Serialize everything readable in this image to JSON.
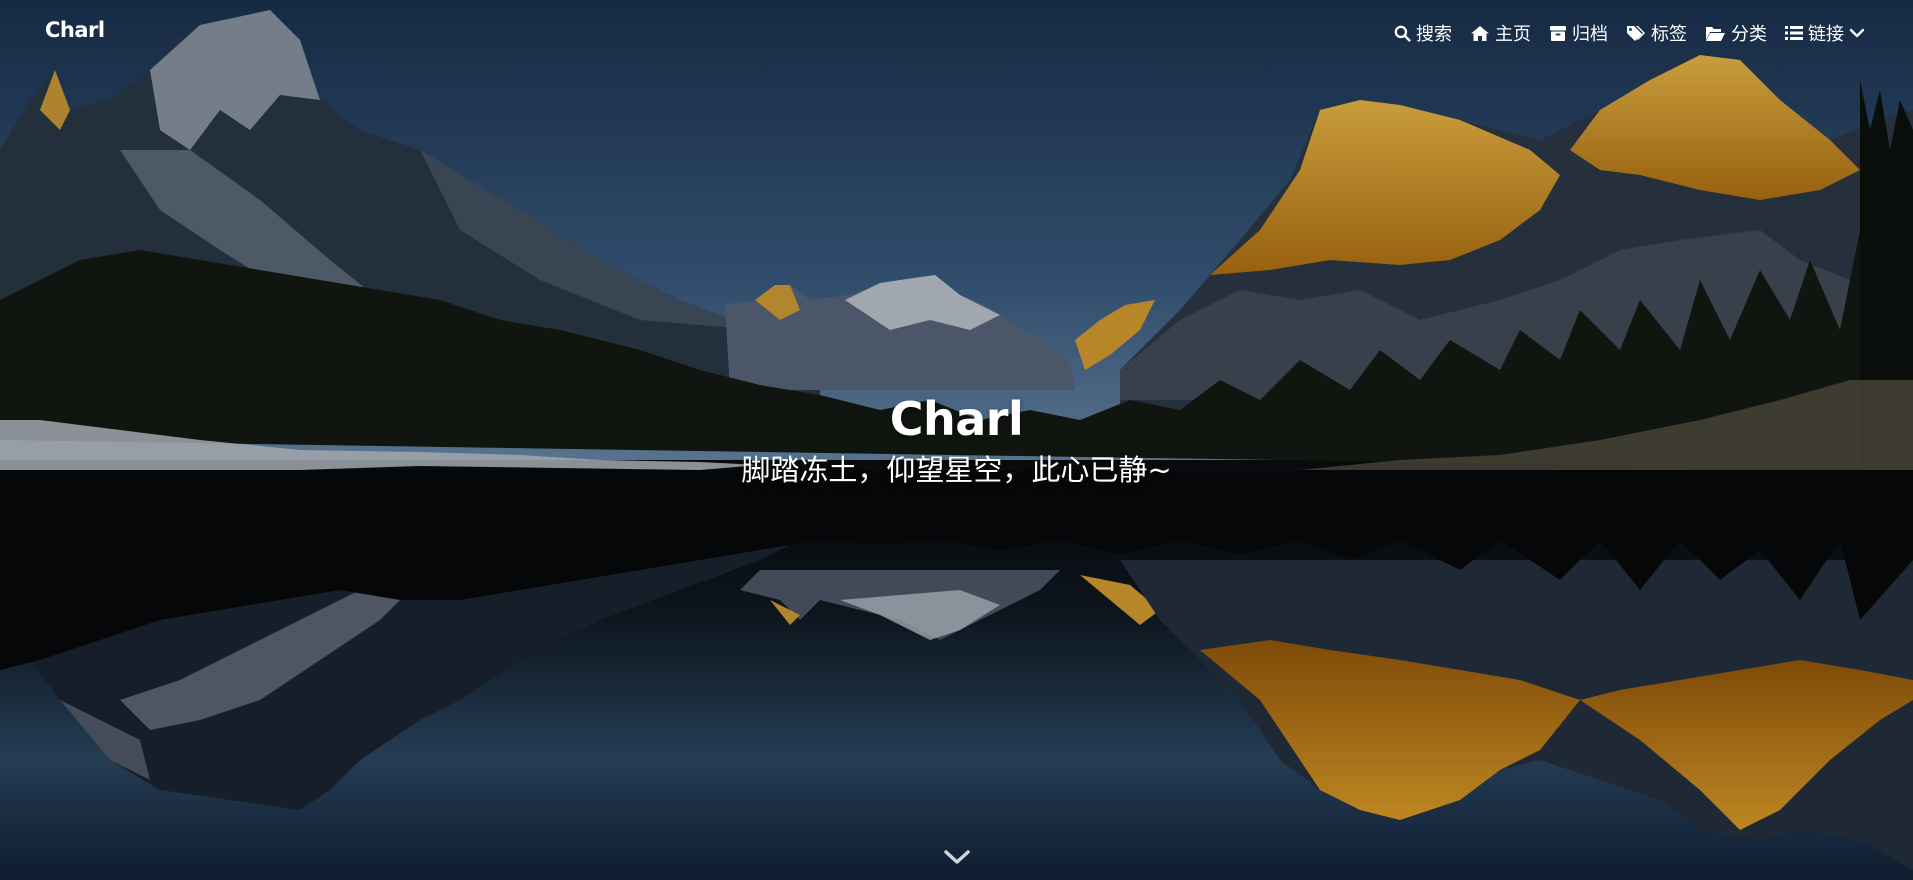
{
  "header": {
    "brand": "Charl",
    "menu": [
      {
        "label": "搜索",
        "icon": "search-icon"
      },
      {
        "label": "主页",
        "icon": "home-icon"
      },
      {
        "label": "归档",
        "icon": "archive-icon"
      },
      {
        "label": "标签",
        "icon": "tags-icon"
      },
      {
        "label": "分类",
        "icon": "folder-open-icon"
      },
      {
        "label": "链接",
        "icon": "list-icon",
        "dropdown_icon": "chevron-down-icon"
      }
    ]
  },
  "hero": {
    "title": "Charl",
    "subtitle": "脚踏冻土，仰望星空，此心已静~",
    "scroll_icon": "chevron-down-icon"
  },
  "colors": {
    "sky_top": "#1c3553",
    "sky_mid": "#46698f",
    "peak_gold": "#e9a628",
    "snow": "#c9d2dc",
    "water": "#14202f",
    "text": "#ffffff"
  }
}
